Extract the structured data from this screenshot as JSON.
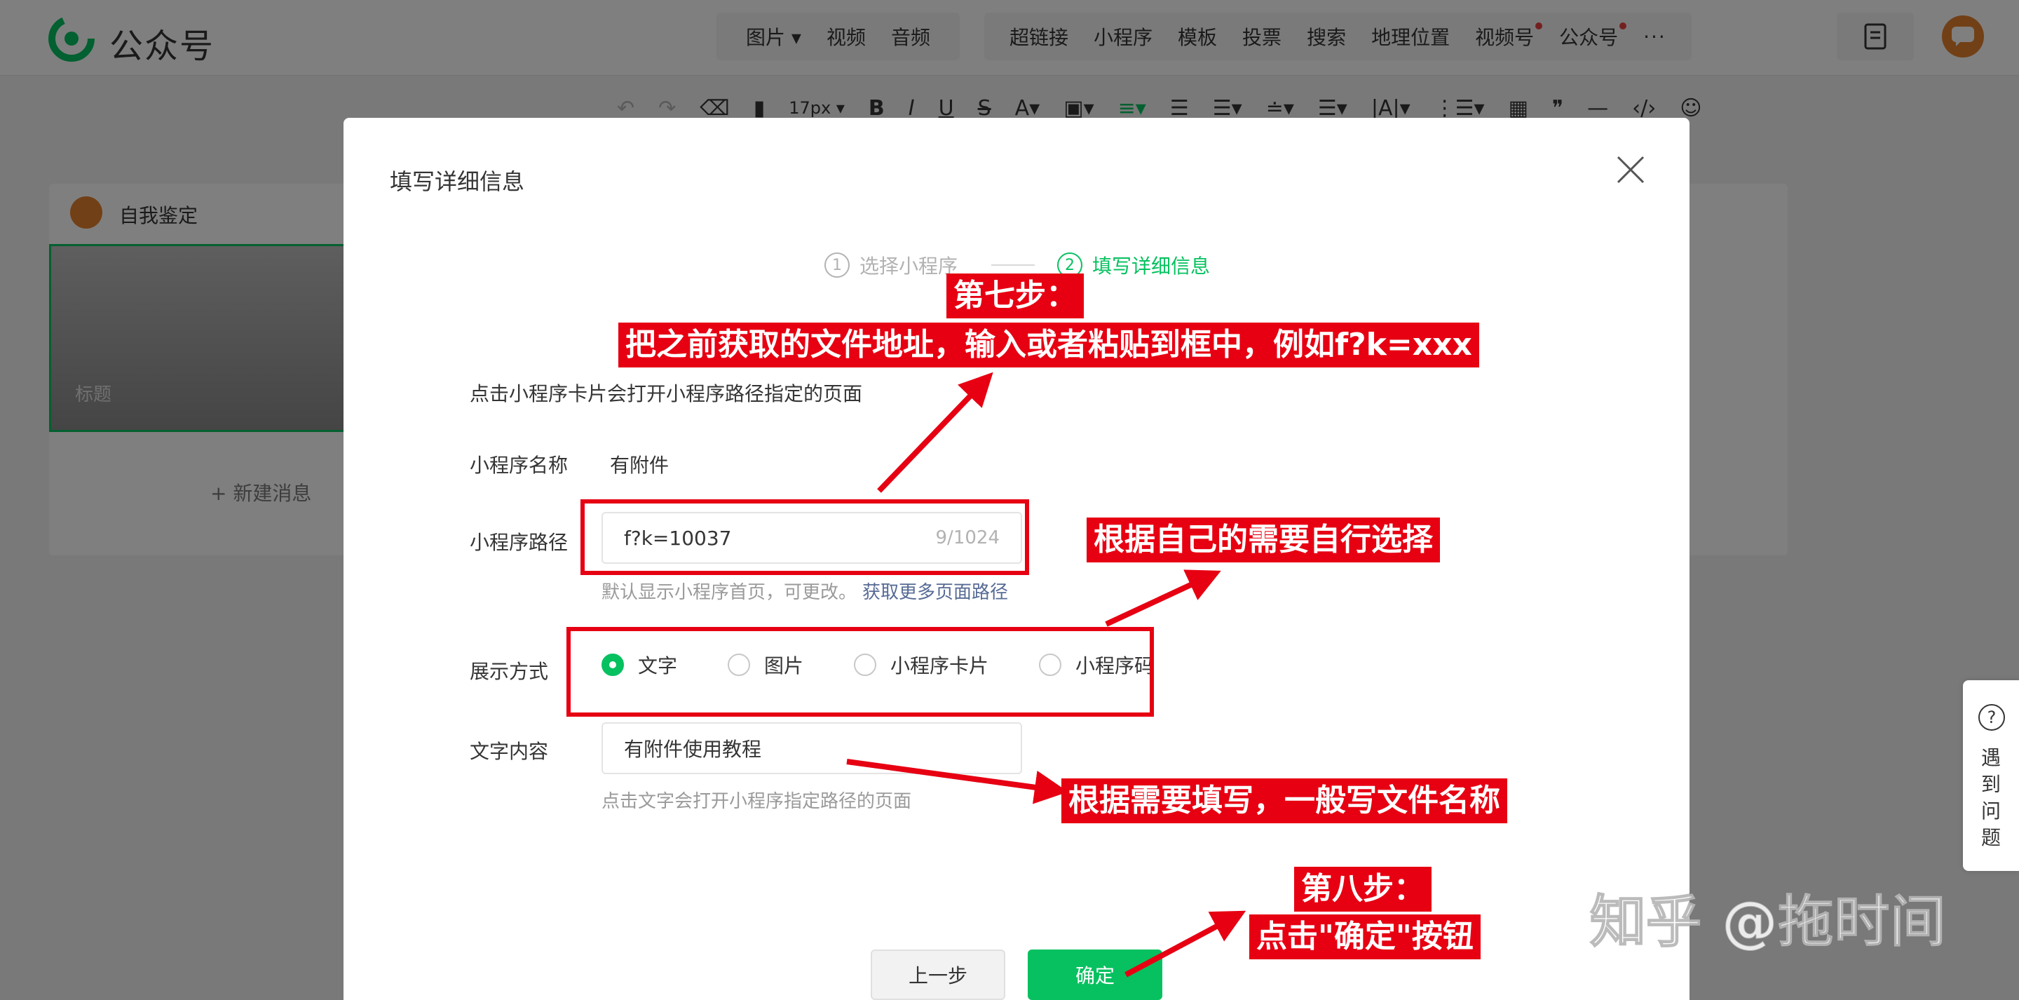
{
  "brand": {
    "name": "公众号"
  },
  "topbar": {
    "media": [
      "图片",
      "视频",
      "音频"
    ],
    "insert": [
      "超链接",
      "小程序",
      "模板",
      "投票",
      "搜索",
      "地理位置",
      "视频号",
      "公众号"
    ],
    "more": "···"
  },
  "toolbar": {
    "font_size": "17px"
  },
  "left_panel": {
    "title": "自我鉴定",
    "cover_label": "标题",
    "new_message": "+ 新建消息"
  },
  "dialog": {
    "title": "填写详细信息",
    "steps": [
      {
        "num": "1",
        "label": "选择小程序"
      },
      {
        "num": "2",
        "label": "填写详细信息"
      }
    ],
    "description": "点击小程序卡片会打开小程序路径指定的页面",
    "name_label": "小程序名称",
    "name_value": "有附件",
    "path_label": "小程序路径",
    "path_value": "f?k=10037",
    "path_count": "9/1024",
    "path_hint": "默认显示小程序首页，可更改。",
    "path_link": "获取更多页面路径",
    "display_label": "展示方式",
    "display_options": [
      "文字",
      "图片",
      "小程序卡片",
      "小程序码"
    ],
    "text_label": "文字内容",
    "text_value": "有附件使用教程",
    "text_hint": "点击文字会打开小程序指定路径的页面",
    "prev_button": "上一步",
    "ok_button": "确定"
  },
  "help": {
    "text": "遇到问题"
  },
  "annotations": {
    "step7_title": "第七步：",
    "step7_text": "把之前获取的文件地址，输入或者粘贴到框中，例如f?k=xxx",
    "choose_text": "根据自己的需要自行选择",
    "fill_text": "根据需要填写，一般写文件名称",
    "step8_title": "第八步：",
    "step8_text": "点击\"确定\"按钮"
  },
  "watermark": "知乎 @拖时间",
  "colors": {
    "accent": "#07c160",
    "annotation": "#e60012",
    "link": "#576b95"
  }
}
